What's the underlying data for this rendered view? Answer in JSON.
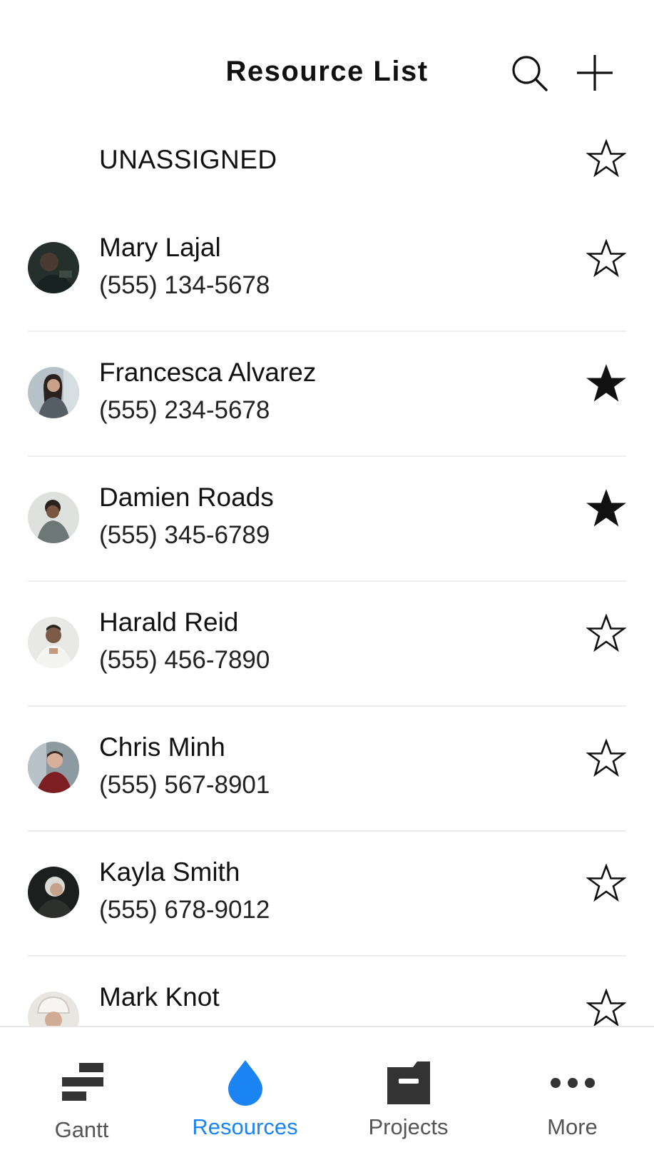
{
  "header": {
    "title": "Resource List"
  },
  "unassigned": {
    "label": "UNASSIGNED",
    "starred": false
  },
  "resources": [
    {
      "name": "Mary Lajal",
      "phone": "(555) 134-5678",
      "starred": false
    },
    {
      "name": "Francesca Alvarez",
      "phone": "(555) 234-5678",
      "starred": true
    },
    {
      "name": "Damien Roads",
      "phone": "(555) 345-6789",
      "starred": true
    },
    {
      "name": "Harald Reid",
      "phone": "(555) 456-7890",
      "starred": false
    },
    {
      "name": "Chris Minh",
      "phone": "(555) 567-8901",
      "starred": false
    },
    {
      "name": "Kayla Smith",
      "phone": "(555) 678-9012",
      "starred": false
    },
    {
      "name": "Mark Knot",
      "phone": "",
      "starred": false
    }
  ],
  "tabs": [
    {
      "label": "Gantt",
      "icon": "gantt-icon",
      "active": false
    },
    {
      "label": "Resources",
      "icon": "water-drop-icon",
      "active": true
    },
    {
      "label": "Projects",
      "icon": "folder-icon",
      "active": false
    },
    {
      "label": "More",
      "icon": "more-dots-icon",
      "active": false
    }
  ],
  "colors": {
    "accent": "#1a84f3",
    "icon_dark": "#333333"
  }
}
